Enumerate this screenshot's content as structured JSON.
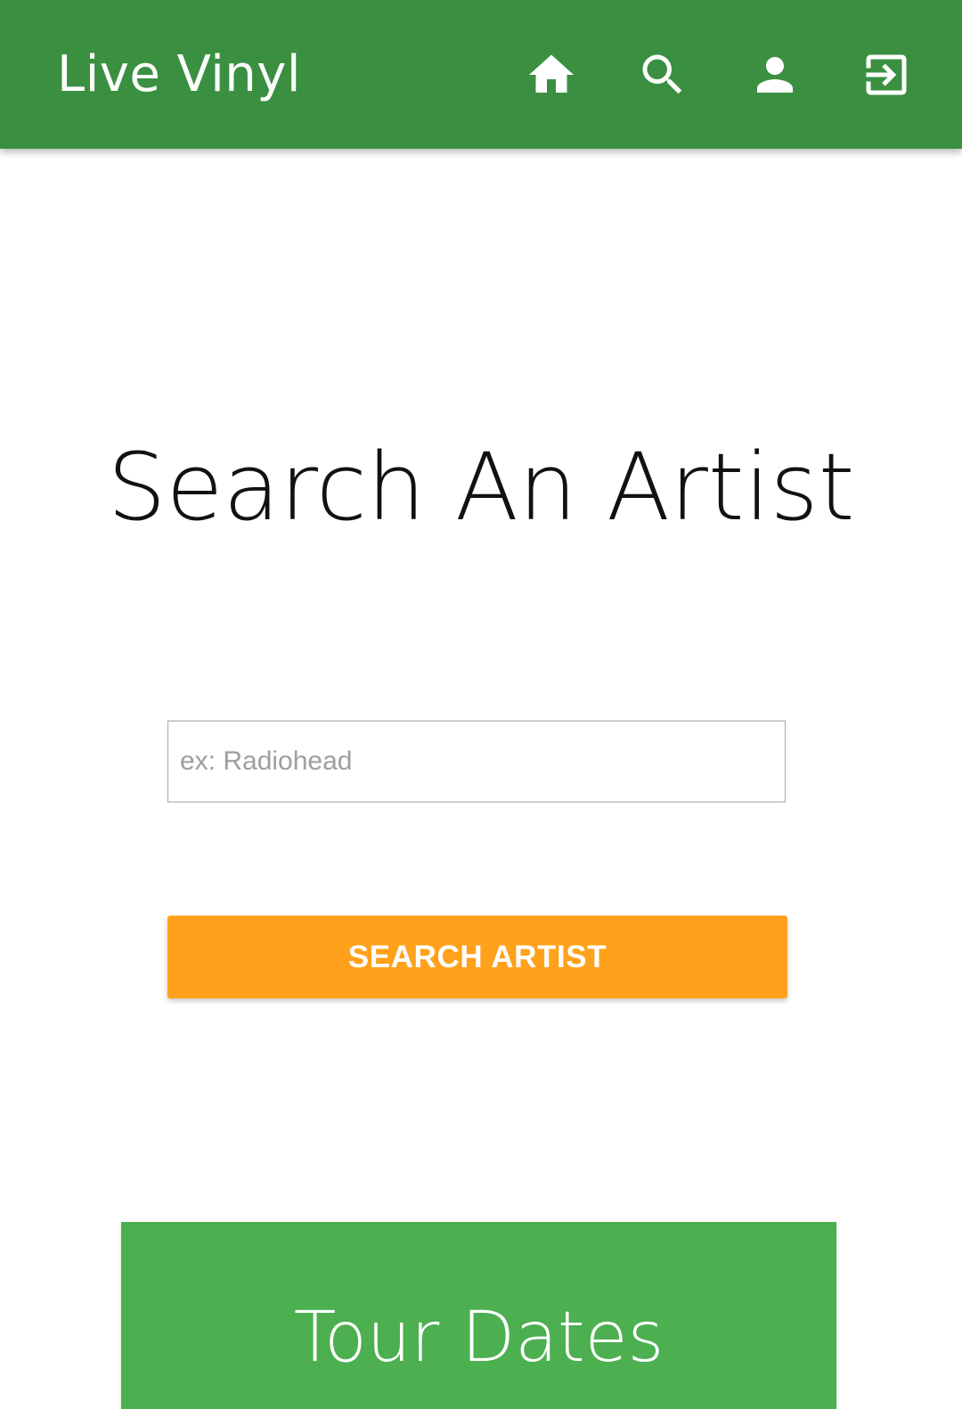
{
  "header": {
    "brand": "Live Vinyl",
    "background_color": "#3a9040",
    "nav": [
      {
        "icon": "home-icon",
        "label": "Home"
      },
      {
        "icon": "search-icon",
        "label": "Search"
      },
      {
        "icon": "account-icon",
        "label": "Account"
      },
      {
        "icon": "logout-icon",
        "label": "Log out"
      }
    ]
  },
  "main": {
    "title": "Search An Artist",
    "search_input": {
      "value": "",
      "placeholder": "ex: Radiohead"
    },
    "search_button": {
      "label": "SEARCH ARTIST",
      "color": "#ffa11b"
    }
  },
  "tour_card": {
    "title": "Tour Dates",
    "color": "#4caf50"
  }
}
